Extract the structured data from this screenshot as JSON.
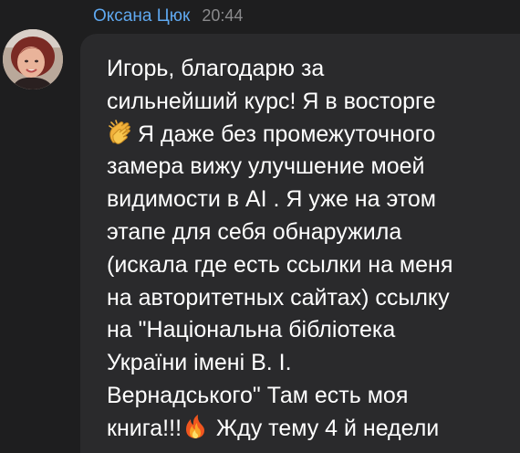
{
  "message": {
    "sender": "Оксана Цюк",
    "time": "20:44",
    "lines": {
      "l1": "Игорь, благодарю за",
      "l2": "сильнейший курс! Я в восторге",
      "l3": "Я даже без промежуточного",
      "l4": "замера вижу улучшение  моей",
      "l5": "видимости  в AI . Я  уже на этом",
      "l6": "этапе для себя обнаружила",
      "l7": "(искала где есть ссылки на меня",
      "l8": "на авторитетных сайтах) ссылку",
      "l9": "на \"Національна бібліотека",
      "l10": "України імені В. І.",
      "l11": "Вернадського\" Там есть моя",
      "l12a": "книга!!!",
      "l12b": "Жду  тему 4 й недели"
    },
    "emojis": [
      "clapping-hands",
      "fire"
    ]
  },
  "colors": {
    "background": "#1e1e1f",
    "bubble": "#2a2a2c",
    "sender_name": "#5fa8ef",
    "timestamp": "#8a8a8c",
    "text": "#ffffff"
  }
}
